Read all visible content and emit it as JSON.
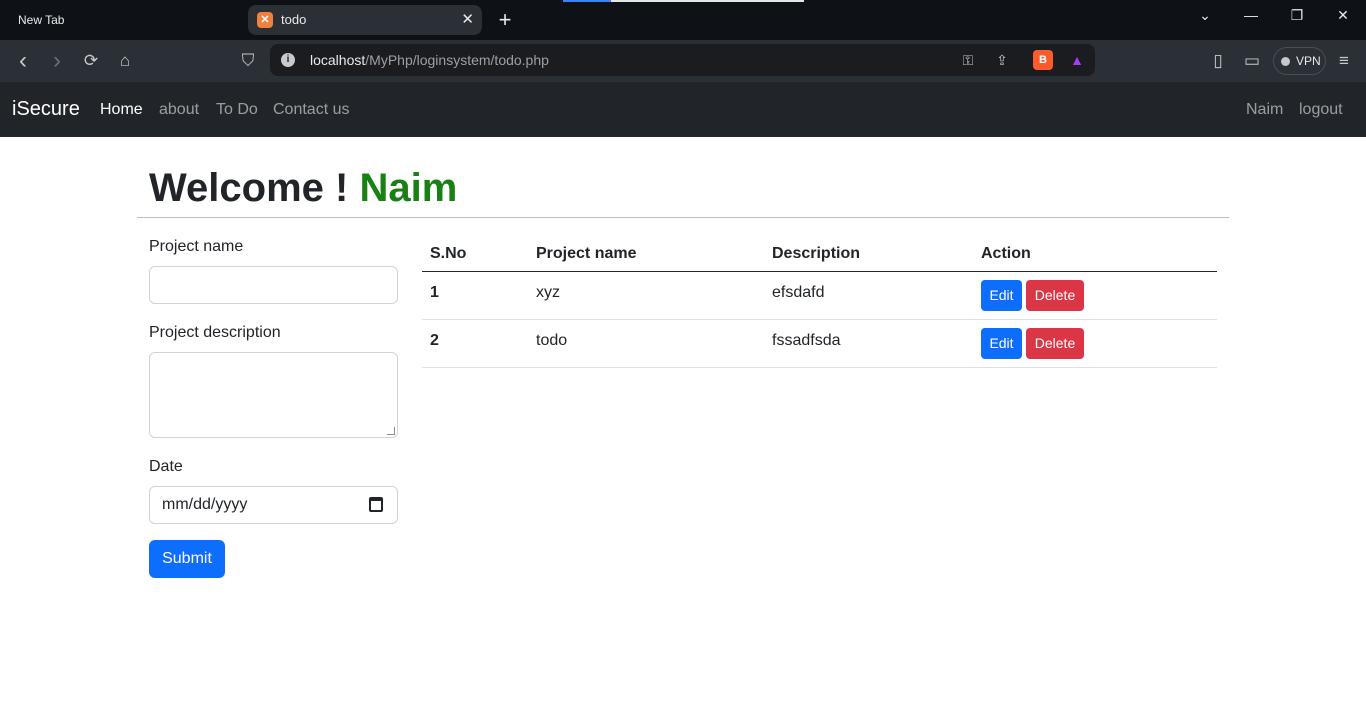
{
  "browser": {
    "tabs": [
      {
        "title": "New Tab"
      },
      {
        "title": "todo"
      }
    ],
    "favicon_letter": "✕",
    "url_host": "localhost",
    "url_path": "/MyPhp/loginsystem/todo.php",
    "vpn_label": "VPN",
    "icons": {
      "back": "‹",
      "forward": "›",
      "reload": "⟳",
      "home": "⌂",
      "bookmark": "⛉",
      "info": "i",
      "key": "⚿",
      "share": "⇪",
      "brave": "B",
      "rewards": "▲",
      "sidebar": "▯",
      "wallet": "▭",
      "menu": "≡",
      "chevron": "⌄",
      "minimize": "—",
      "restore": "❐",
      "close": "✕",
      "new_tab": "+"
    }
  },
  "navbar": {
    "brand": "iSecure",
    "links": [
      {
        "label": "Home",
        "active": true
      },
      {
        "label": "about",
        "active": false
      },
      {
        "label": "To Do",
        "active": false
      },
      {
        "label": "Contact us",
        "active": false
      }
    ],
    "user": "Naim",
    "logout": "logout"
  },
  "main": {
    "welcome_prefix": "Welcome !",
    "welcome_user": "Naim",
    "form": {
      "project_name_label": "Project name",
      "project_name_value": "",
      "description_label": "Project description",
      "description_value": "",
      "date_label": "Date",
      "date_placeholder": "mm/dd/yyyy",
      "submit_label": "Submit"
    },
    "table": {
      "headers": [
        "S.No",
        "Project name",
        "Description",
        "Action"
      ],
      "rows": [
        {
          "sno": "1",
          "name": "xyz",
          "description": "efsdafd"
        },
        {
          "sno": "2",
          "name": "todo",
          "description": "fssadfsda"
        }
      ],
      "edit_label": "Edit",
      "delete_label": "Delete"
    }
  },
  "colors": {
    "primary": "#0d6efd",
    "danger": "#dc3545",
    "navbar_bg": "#212529",
    "welcome_user": "#198013"
  }
}
